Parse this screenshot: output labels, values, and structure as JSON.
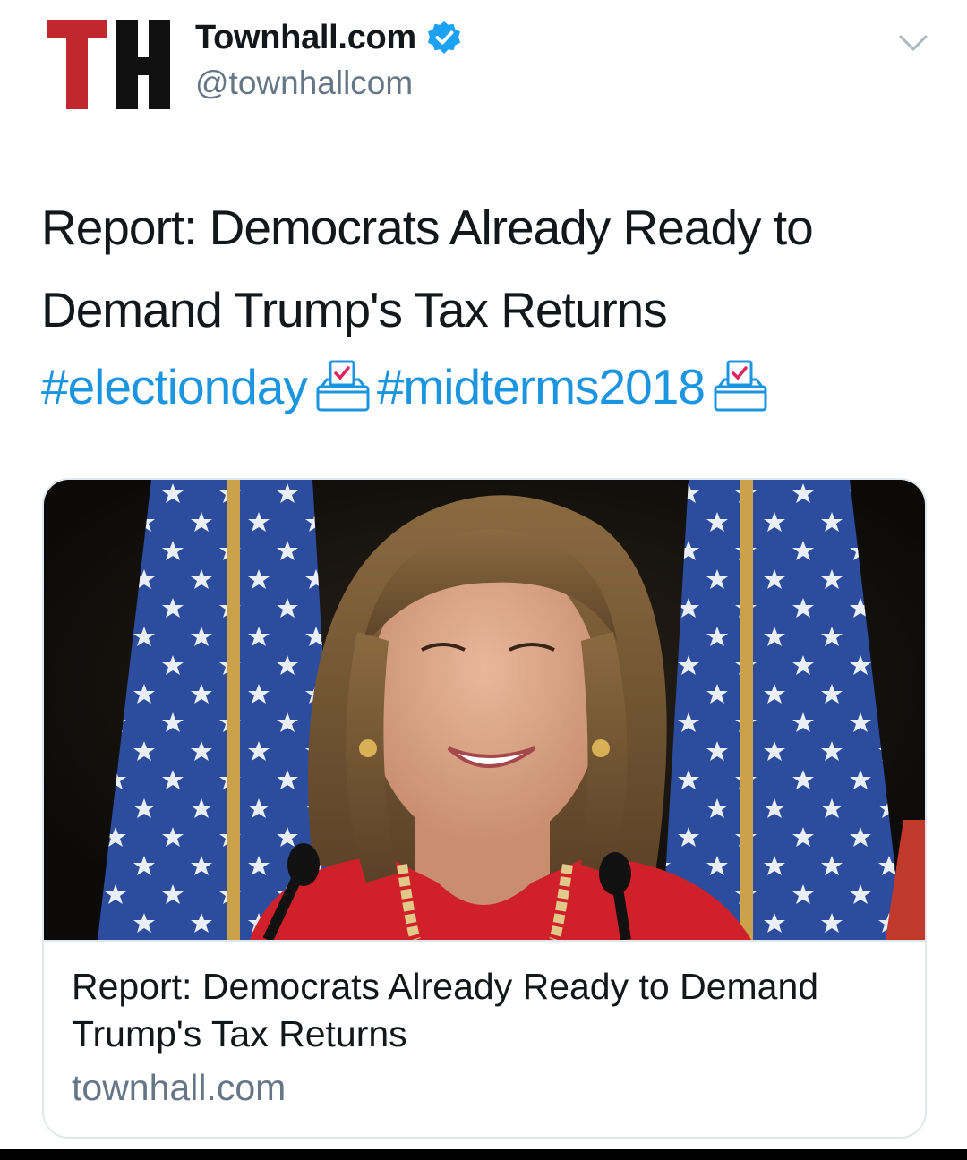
{
  "account": {
    "logo_text": "TH",
    "display_name": "Townhall.com",
    "handle": "@townhallcom",
    "verified_icon": "verified-badge-icon"
  },
  "menu": {
    "icon": "chevron-down-icon"
  },
  "tweet": {
    "text": "Report: Democrats Already Ready to Demand Trump's Tax Returns",
    "hashtags": [
      "#electionday",
      "#midterms2018"
    ],
    "emoji_icon": "ballot-box-with-ballot-icon"
  },
  "card": {
    "image_alt": "photo",
    "title": "Report: Democrats Already Ready to Demand Trump's Tax Returns",
    "domain": "townhall.com"
  },
  "colors": {
    "brand_red": "#c1272d",
    "logo_black": "#111111",
    "hashtag_blue": "#1b95e0",
    "verified_blue": "#1da1f2",
    "muted_gray": "#657786",
    "border": "#e1e8ed"
  }
}
